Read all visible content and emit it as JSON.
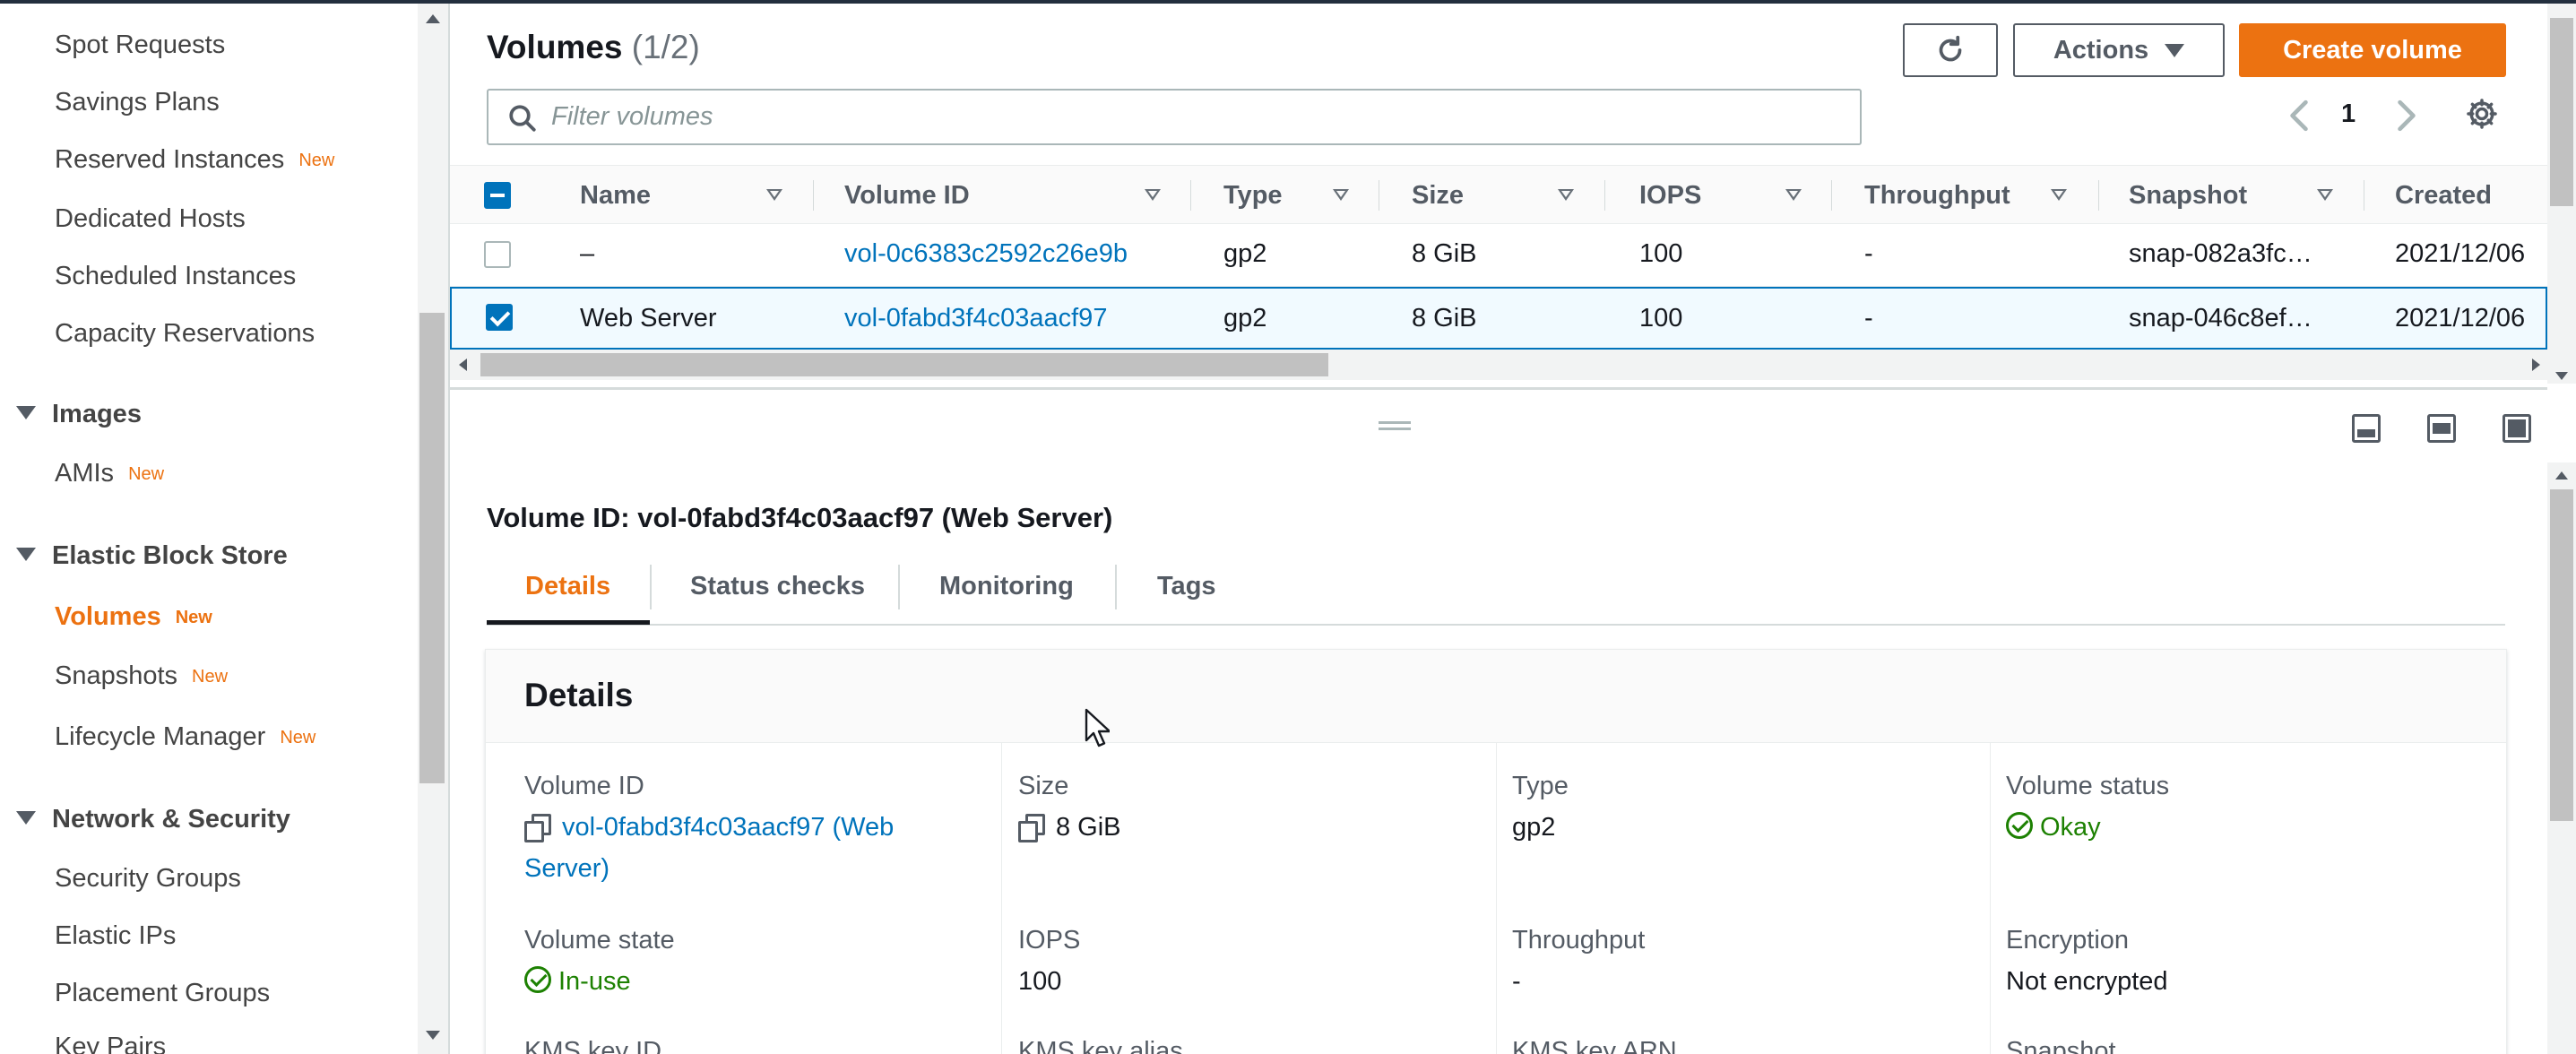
{
  "colors": {
    "accent": "#ec7211",
    "link": "#0073bb",
    "ok": "#1d8102",
    "text": "#16191f",
    "muted": "#545b64"
  },
  "sidebar": {
    "items": [
      {
        "label": "Spot Requests"
      },
      {
        "label": "Savings Plans"
      },
      {
        "label": "Reserved Instances",
        "badge": "New"
      },
      {
        "label": "Dedicated Hosts"
      },
      {
        "label": "Scheduled Instances"
      },
      {
        "label": "Capacity Reservations"
      }
    ],
    "images": {
      "header": "Images",
      "items": [
        {
          "label": "AMIs",
          "badge": "New"
        }
      ]
    },
    "ebs": {
      "header": "Elastic Block Store",
      "items": [
        {
          "label": "Volumes",
          "badge": "New"
        },
        {
          "label": "Snapshots",
          "badge": "New"
        },
        {
          "label": "Lifecycle Manager",
          "badge": "New"
        }
      ]
    },
    "network": {
      "header": "Network & Security",
      "items": [
        {
          "label": "Security Groups"
        },
        {
          "label": "Elastic IPs"
        },
        {
          "label": "Placement Groups"
        },
        {
          "label": "Key Pairs"
        }
      ]
    }
  },
  "header": {
    "title": "Volumes",
    "count": "(1/2)",
    "actions_label": "Actions",
    "create_label": "Create volume",
    "refresh_icon": "refresh-icon"
  },
  "search": {
    "placeholder": "Filter volumes",
    "value": ""
  },
  "pagination": {
    "page": "1"
  },
  "table": {
    "columns": [
      "Name",
      "Volume ID",
      "Type",
      "Size",
      "IOPS",
      "Throughput",
      "Snapshot",
      "Created"
    ],
    "rows": [
      {
        "selected": false,
        "name": "–",
        "volume_id": "vol-0c6383c2592c26e9b",
        "type": "gp2",
        "size": "8 GiB",
        "iops": "100",
        "throughput": "-",
        "snapshot": "snap-082a3fc…",
        "created": "2021/12/06"
      },
      {
        "selected": true,
        "name": "Web Server",
        "volume_id": "vol-0fabd3f4c03aacf97",
        "type": "gp2",
        "size": "8 GiB",
        "iops": "100",
        "throughput": "-",
        "snapshot": "snap-046c8ef…",
        "created": "2021/12/06"
      }
    ]
  },
  "detail": {
    "title": "Volume ID: vol-0fabd3f4c03aacf97 (Web Server)",
    "tabs": [
      {
        "label": "Details",
        "active": true
      },
      {
        "label": "Status checks"
      },
      {
        "label": "Monitoring"
      },
      {
        "label": "Tags"
      }
    ],
    "panel_title": "Details",
    "fields": {
      "volume_id": {
        "label": "Volume ID",
        "value_line1": "vol-0fabd3f4c03aacf97 (Web",
        "value_line2": "Server)"
      },
      "size": {
        "label": "Size",
        "value": "8 GiB"
      },
      "type": {
        "label": "Type",
        "value": "gp2"
      },
      "volume_status": {
        "label": "Volume status",
        "value": "Okay"
      },
      "volume_state": {
        "label": "Volume state",
        "value": "In-use"
      },
      "iops": {
        "label": "IOPS",
        "value": "100"
      },
      "throughput": {
        "label": "Throughput",
        "value": "-"
      },
      "encryption": {
        "label": "Encryption",
        "value": "Not encrypted"
      },
      "kms_key_id": {
        "label": "KMS key ID"
      },
      "kms_key_alias": {
        "label": "KMS key alias"
      },
      "kms_key_arn": {
        "label": "KMS key ARN"
      },
      "snapshot": {
        "label": "Snapshot"
      }
    }
  }
}
